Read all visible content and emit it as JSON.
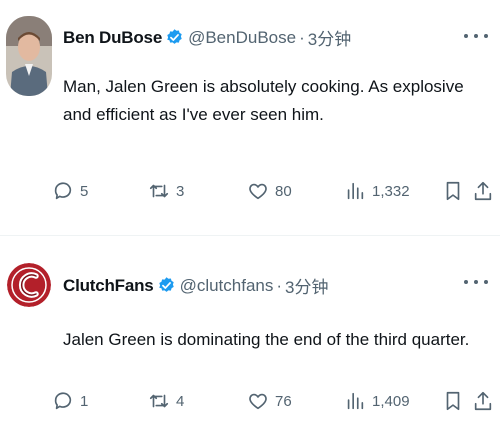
{
  "tweets": [
    {
      "display_name": "Ben DuBose",
      "handle": "@BenDuBose",
      "dot": "·",
      "time": "3分钟",
      "text": "Man, Jalen Green is absolutely cooking. As explosive and efficient as I've ever seen him.",
      "replies": "5",
      "retweets": "3",
      "likes": "80",
      "views": "1,332"
    },
    {
      "display_name": "ClutchFans",
      "handle": "@clutchfans",
      "dot": "·",
      "time": "3分钟",
      "text": "Jalen Green is dominating the end of the third quarter.",
      "replies": "1",
      "retweets": "4",
      "likes": "76",
      "views": "1,409"
    }
  ],
  "icons": {
    "verified": "verified-badge-icon",
    "more": "more-icon",
    "reply": "reply-icon",
    "retweet": "retweet-icon",
    "like": "heart-icon",
    "views": "views-icon",
    "bookmark": "bookmark-icon",
    "share": "share-icon"
  },
  "colors": {
    "verified_blue": "#1d9bf0",
    "text": "#0f1419",
    "secondary": "#536471",
    "clutchfans_red": "#b3202a"
  }
}
